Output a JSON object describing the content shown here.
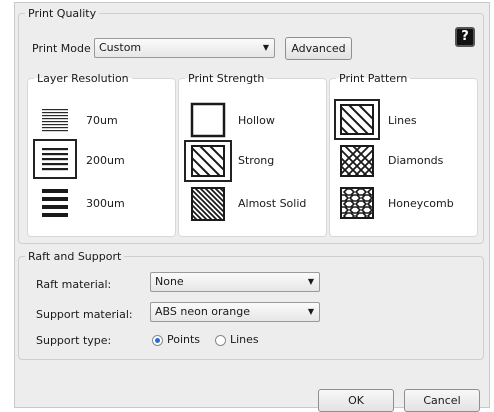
{
  "print_quality": {
    "title": "Print Quality",
    "help_label": "?",
    "print_mode": {
      "label": "Print Mode",
      "value": "Custom",
      "advanced_label": "Advanced"
    },
    "layer_resolution": {
      "title": "Layer Resolution",
      "options": [
        {
          "label": "70um",
          "icon": "fine-lines-icon",
          "selected": false
        },
        {
          "label": "200um",
          "icon": "medium-lines-icon",
          "selected": true
        },
        {
          "label": "300um",
          "icon": "thick-lines-icon",
          "selected": false
        }
      ]
    },
    "print_strength": {
      "title": "Print Strength",
      "options": [
        {
          "label": "Hollow",
          "icon": "hollow-square-icon",
          "selected": false
        },
        {
          "label": "Strong",
          "icon": "sparse-hatch-icon",
          "selected": true
        },
        {
          "label": "Almost Solid",
          "icon": "dense-hatch-icon",
          "selected": false
        }
      ]
    },
    "print_pattern": {
      "title": "Print Pattern",
      "options": [
        {
          "label": "Lines",
          "icon": "lines-pattern-icon",
          "selected": true
        },
        {
          "label": "Diamonds",
          "icon": "diamonds-pattern-icon",
          "selected": false
        },
        {
          "label": "Honeycomb",
          "icon": "honeycomb-pattern-icon",
          "selected": false
        }
      ]
    }
  },
  "raft_support": {
    "title": "Raft and Support",
    "raft_material": {
      "label": "Raft material:",
      "value": "None"
    },
    "support_material": {
      "label": "Support material:",
      "value": "ABS neon orange"
    },
    "support_type": {
      "label": "Support type:",
      "options": [
        {
          "label": "Points",
          "selected": true
        },
        {
          "label": "Lines",
          "selected": false
        }
      ]
    }
  },
  "buttons": {
    "ok": "OK",
    "cancel": "Cancel"
  },
  "colors": {
    "panel_bg": "#ededed",
    "selection_border": "#222222",
    "radio_selected": "#2a6ad8"
  }
}
